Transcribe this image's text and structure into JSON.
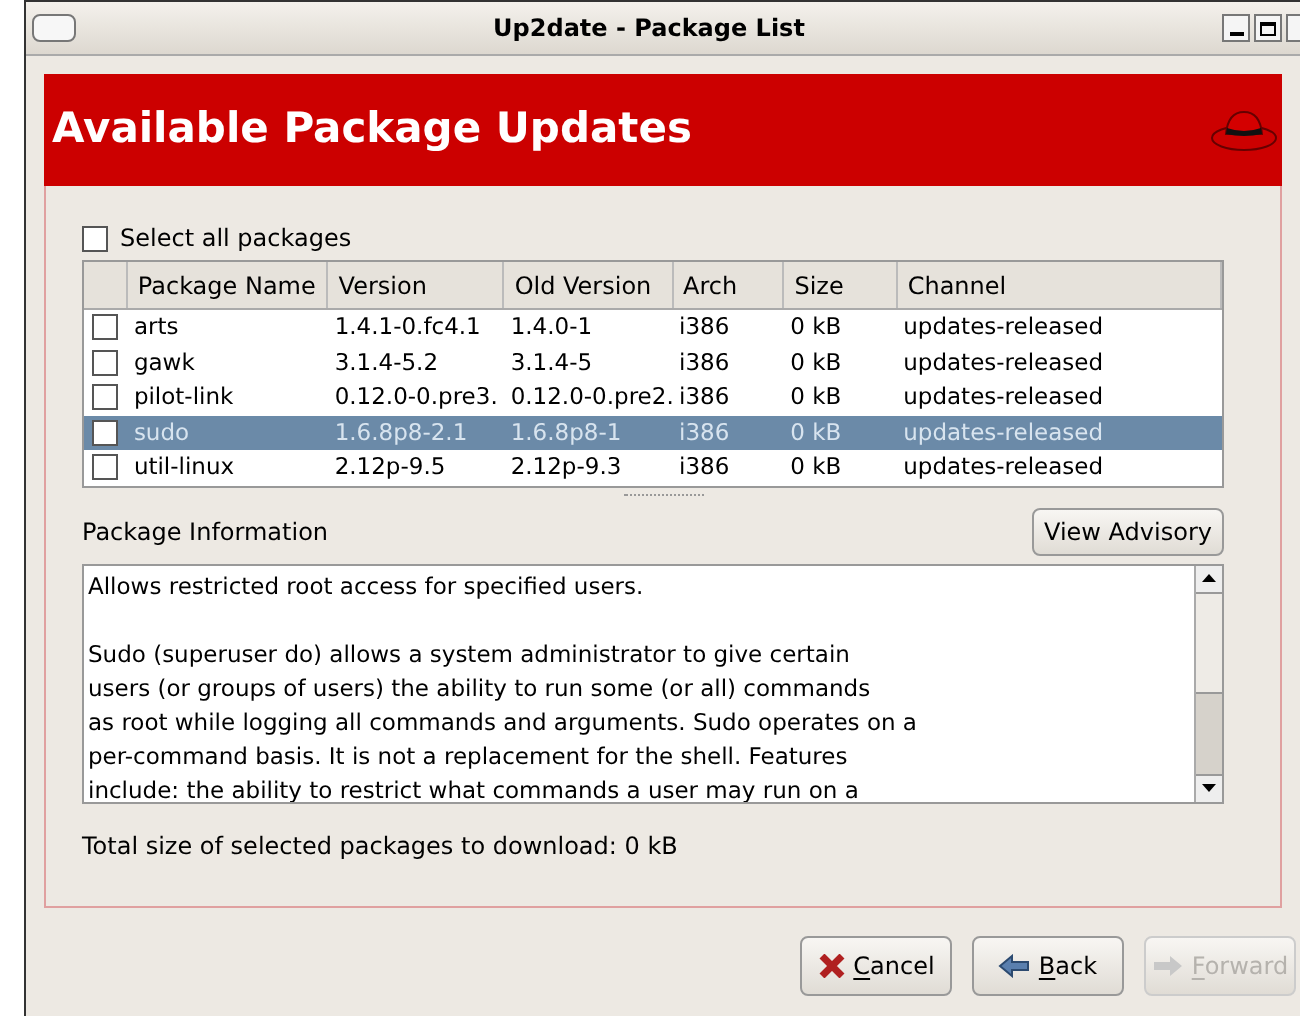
{
  "window": {
    "title": "Up2date - Package List"
  },
  "header": {
    "title": "Available Package Updates"
  },
  "select_all": {
    "label": "Select all packages",
    "checked": false
  },
  "table": {
    "columns": [
      "Package Name",
      "Version",
      "Old Version",
      "Arch",
      "Size",
      "Channel"
    ],
    "rows": [
      {
        "cells": [
          "arts",
          "1.4.1-0.fc4.1",
          "1.4.0-1",
          "i386",
          "0 kB",
          "updates-released"
        ],
        "checked": false,
        "selected": false
      },
      {
        "cells": [
          "gawk",
          "3.1.4-5.2",
          "3.1.4-5",
          "i386",
          "0 kB",
          "updates-released"
        ],
        "checked": false,
        "selected": false
      },
      {
        "cells": [
          "pilot-link",
          "0.12.0-0.pre3.",
          "0.12.0-0.pre2.",
          "i386",
          "0 kB",
          "updates-released"
        ],
        "checked": false,
        "selected": false
      },
      {
        "cells": [
          "sudo",
          "1.6.8p8-2.1",
          "1.6.8p8-1",
          "i386",
          "0 kB",
          "updates-released"
        ],
        "checked": false,
        "selected": true
      },
      {
        "cells": [
          "util-linux",
          "2.12p-9.5",
          "2.12p-9.3",
          "i386",
          "0 kB",
          "updates-released"
        ],
        "checked": false,
        "selected": false
      }
    ]
  },
  "info": {
    "label": "Package Information",
    "button": "View Advisory",
    "paragraphs": [
      [
        "Allows restricted root access for specified users."
      ],
      [
        "Sudo (superuser do) allows a system administrator to give certain",
        "users (or groups of users) the ability to run some (or all) commands",
        "as root while logging all commands and arguments. Sudo operates on a",
        "per-command basis. It is not a replacement for the shell. Features",
        "include: the ability to restrict what commands a user may run on a"
      ]
    ]
  },
  "total": "Total size of selected packages to download: 0 kB",
  "buttons": [
    {
      "kind": "cancel",
      "label": "Cancel",
      "disabled": false
    },
    {
      "kind": "back",
      "label": "Back",
      "disabled": false
    },
    {
      "kind": "forward",
      "label": "Forward",
      "disabled": true
    }
  ]
}
